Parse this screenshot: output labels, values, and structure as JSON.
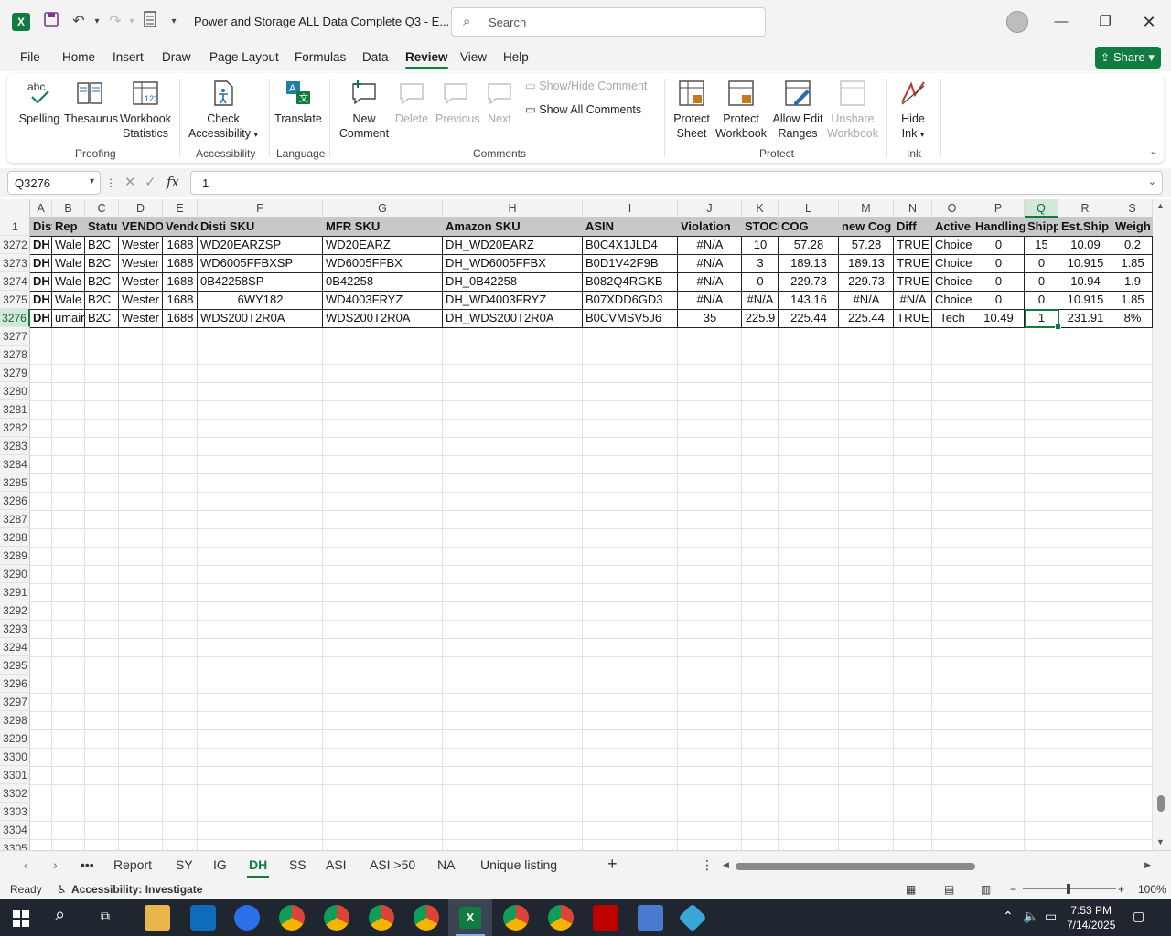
{
  "titlebar": {
    "title": "Power and Storage ALL Data Complete Q3  -  E...",
    "search_placeholder": "Search"
  },
  "menu": [
    "File",
    "Home",
    "Insert",
    "Draw",
    "Page Layout",
    "Formulas",
    "Data",
    "Review",
    "View",
    "Help"
  ],
  "active_menu": "Review",
  "share_label": "Share",
  "ribbon": {
    "spelling": "Spelling",
    "thesaurus": "Thesaurus",
    "workbook_stats_1": "Workbook",
    "workbook_stats_2": "Statistics",
    "proofing": "Proofing",
    "check_acc_1": "Check",
    "check_acc_2": "Accessibility",
    "accessibility": "Accessibility",
    "translate": "Translate",
    "language": "Language",
    "new_comment_1": "New",
    "new_comment_2": "Comment",
    "delete": "Delete",
    "previous": "Previous",
    "next": "Next",
    "show_hide_comment": "Show/Hide Comment",
    "show_all_comments": "Show All Comments",
    "comments": "Comments",
    "protect_sheet_1": "Protect",
    "protect_sheet_2": "Sheet",
    "protect_wb_1": "Protect",
    "protect_wb_2": "Workbook",
    "allow_edit_1": "Allow Edit",
    "allow_edit_2": "Ranges",
    "unshare_1": "Unshare",
    "unshare_2": "Workbook",
    "protect": "Protect",
    "hide_ink_1": "Hide",
    "hide_ink_2": "Ink",
    "ink": "Ink"
  },
  "formula_bar": {
    "name_box": "Q3276",
    "fx": "fx",
    "value": "1"
  },
  "columns": [
    "A",
    "B",
    "C",
    "D",
    "E",
    "F",
    "G",
    "H",
    "I",
    "J",
    "K",
    "L",
    "M",
    "N",
    "O",
    "P",
    "Q",
    "R",
    "S"
  ],
  "header_row": {
    "row_num": "1",
    "cells": [
      "Disti",
      "Rep",
      "Statu",
      "VENDO",
      "Vendo",
      "Disti SKU",
      "MFR SKU",
      "Amazon SKU",
      "ASIN",
      "Violation",
      "STOCK",
      "COG",
      "new Cog",
      "Diff",
      "Active",
      "Handling",
      "Shipp",
      "Est.Ship",
      "Weigh"
    ]
  },
  "rows": [
    {
      "num": "3272",
      "cells": [
        "DH",
        "Wale",
        "B2C",
        "Wester",
        "1688",
        "WD20EARZSP",
        "WD20EARZ",
        "DH_WD20EARZ",
        "B0C4X1JLD4",
        "#N/A",
        "10",
        "57.28",
        "57.28",
        "TRUE",
        "Choice",
        "0",
        "15",
        "10.09",
        "0.2"
      ]
    },
    {
      "num": "3273",
      "cells": [
        "DH",
        "Wale",
        "B2C",
        "Wester",
        "1688",
        "WD6005FFBXSP",
        "WD6005FFBX",
        "DH_WD6005FFBX",
        "B0D1V42F9B",
        "#N/A",
        "3",
        "189.13",
        "189.13",
        "TRUE",
        "Choice",
        "0",
        "0",
        "10.915",
        "1.85"
      ]
    },
    {
      "num": "3274",
      "cells": [
        "DH",
        "Wale",
        "B2C",
        "Wester",
        "1688",
        "0B42258SP",
        "0B42258",
        "DH_0B42258",
        "B082Q4RGKB",
        "#N/A",
        "0",
        "229.73",
        "229.73",
        "TRUE",
        "Choice",
        "0",
        "0",
        "10.94",
        "1.9"
      ]
    },
    {
      "num": "3275",
      "cells": [
        "DH",
        "Wale",
        "B2C",
        "Wester",
        "1688",
        "6WY182",
        "WD4003FRYZ",
        "DH_WD4003FRYZ",
        "B07XDD6GD3",
        "#N/A",
        "#N/A",
        "143.16",
        "#N/A",
        "#N/A",
        "Choice",
        "0",
        "0",
        "10.915",
        "1.85"
      ]
    },
    {
      "num": "3276",
      "cells": [
        "DH",
        "umair",
        "B2C",
        "Wester",
        "1688",
        "WDS200T2R0A",
        "WDS200T2R0A",
        "DH_WDS200T2R0A",
        "B0CVMSV5J6",
        "35",
        "225.9",
        "225.44",
        "225.44",
        "TRUE",
        "Tech",
        "10.49",
        "1",
        "231.91",
        "8%"
      ]
    }
  ],
  "empty_rows": [
    "3277",
    "3278",
    "3279",
    "3280",
    "3281",
    "3282",
    "3283",
    "3284",
    "3285",
    "3286",
    "3287",
    "3288",
    "3289",
    "3290",
    "3291",
    "3292",
    "3293",
    "3294",
    "3295",
    "3296",
    "3297",
    "3298",
    "3299",
    "3300",
    "3301",
    "3302",
    "3303",
    "3304",
    "3305"
  ],
  "sheets": [
    "Report",
    "SY",
    "IG",
    "DH",
    "SS",
    "ASI",
    "ASI >50",
    "NA",
    "Unique listing"
  ],
  "active_sheet": "DH",
  "status": {
    "ready": "Ready",
    "accessibility": "Accessibility: Investigate",
    "zoom": "100%"
  },
  "clock": {
    "time": "7:53 PM",
    "date": "7/14/2025"
  },
  "colors": {
    "accent": "#107c41",
    "header_fill": "#c8c8c8",
    "taskbar": "#1f2630"
  }
}
